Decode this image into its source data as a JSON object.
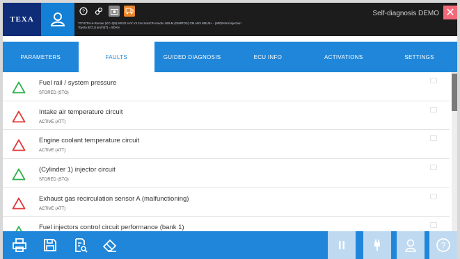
{
  "header": {
    "brand": "TEXA",
    "vehicle_line1": "TOYOTA Hi-Runner (KC+Q8) MS1D 4-D/ V4 24v SoHCR+mode USB-M (GM9TOS) CM ANX MBUS+ - (MR)Petrol injection",
    "vehicle_line2": "Toyota (ECU) and 5(T) = 5DAN",
    "title": "Self-diagnosis DEMO",
    "close_glyph": "✕"
  },
  "tabs": [
    {
      "label": "PARAMETERS",
      "active": false
    },
    {
      "label": "FAULTS",
      "active": true
    },
    {
      "label": "GUIDED DIAGNOSIS",
      "active": false
    },
    {
      "label": "ECU INFO",
      "active": false
    },
    {
      "label": "ACTIVATIONS",
      "active": false
    },
    {
      "label": "SETTINGS",
      "active": false
    }
  ],
  "faults": [
    {
      "name": "Fuel rail / system pressure",
      "status": "STORED (STO)",
      "severity": "stored"
    },
    {
      "name": "Intake air temperature circuit",
      "status": "ACTIVE (ATT)",
      "severity": "active"
    },
    {
      "name": "Engine coolant temperature circuit",
      "status": "ACTIVE (ATT)",
      "severity": "active"
    },
    {
      "name": "(Cylinder 1) injector circuit",
      "status": "STORED (STO)",
      "severity": "stored"
    },
    {
      "name": "Exhaust gas recirculation sensor A (malfunctioning)",
      "status": "ACTIVE (ATT)",
      "severity": "active"
    },
    {
      "name": "Fuel injectors control circuit performance (bank 1)",
      "status": "",
      "severity": "stored"
    }
  ],
  "colors": {
    "accent": "#1f86d9",
    "active_triangle": "#e23a3a",
    "stored_triangle": "#2fb24a",
    "brand_bg": "#0f2c78"
  }
}
